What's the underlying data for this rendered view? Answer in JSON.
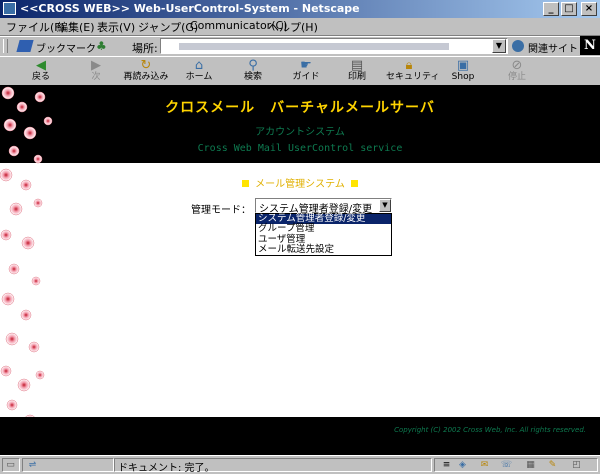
{
  "window": {
    "title": "<<CROSS WEB>> Web-UserControl-System - Netscape"
  },
  "menu": [
    "ファイル(F)",
    "編集(E)",
    "表示(V)",
    "ジャンプ(G)",
    "Communicator(C)",
    "ヘルプ(H)"
  ],
  "location": {
    "bookmark_label": "ブックマーク",
    "location_label": "場所:",
    "related_label": "関連サイト"
  },
  "toolbar": [
    "戻る",
    "次",
    "再読み込み",
    "ホーム",
    "検索",
    "ガイド",
    "印刷",
    "セキュリティ",
    "Shop",
    "停止"
  ],
  "page": {
    "title": "クロスメール　バーチャルメールサーバ",
    "subtitle": "アカウントシステム",
    "service": "Cross Web Mail UserControl service",
    "section_title": "メール管理システム",
    "mode_label": "管理モード：",
    "mode_selected": "システム管理者登録/変更",
    "mode_options": [
      "システム管理者登録/変更",
      "グループ管理",
      "ユーザ管理",
      "メール転送先設定"
    ],
    "copyright": "Copyright (C) 2002 Cross Web, Inc. All rights reserved."
  },
  "status": {
    "text": "ドキュメント: 完了。"
  },
  "colors": {
    "title_text": "#ffd400",
    "sub_text": "#0e7a50",
    "highlight": "#0a246a",
    "bullet": "#ffe400"
  }
}
